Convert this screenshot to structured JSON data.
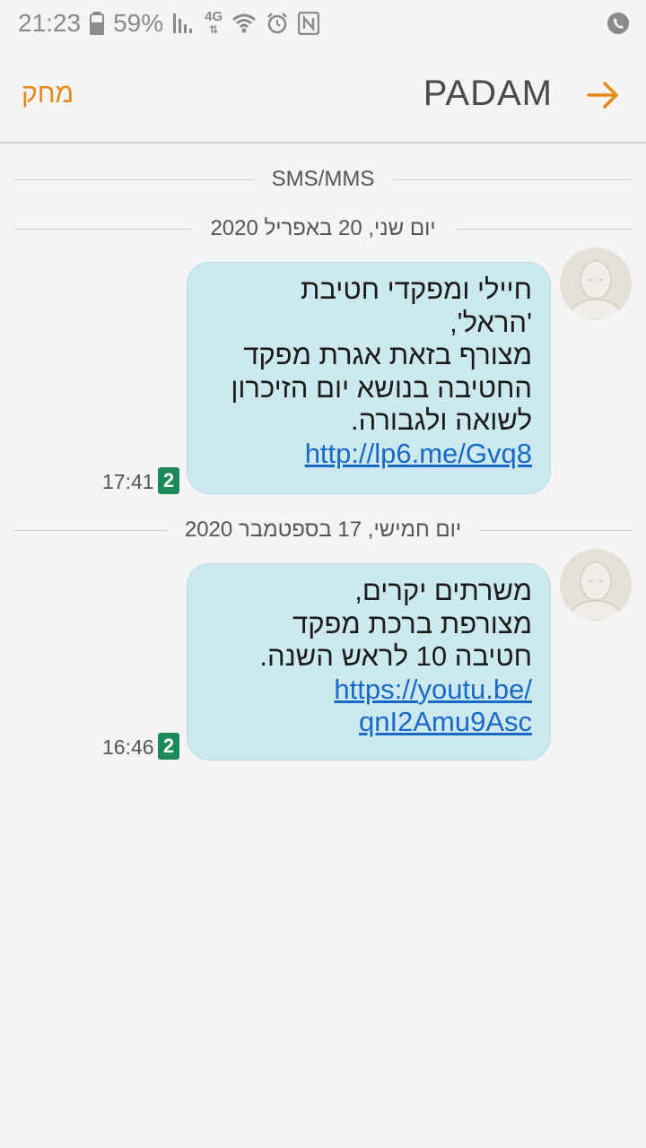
{
  "status_bar": {
    "time": "21:23",
    "battery": "59%",
    "network": "4G",
    "icons": [
      "battery-icon",
      "signal-icon",
      "wifi-icon",
      "alarm-icon",
      "nfc-icon",
      "call-icon"
    ]
  },
  "header": {
    "delete_label": "מחק",
    "title": "PADAM",
    "back_icon": "arrow-right-icon",
    "accent_color": "#e8891c"
  },
  "thread": {
    "type_label": "SMS/MMS",
    "messages": [
      {
        "date": "יום שני, 20 באפריל 2020",
        "lines": [
          "חיילי ומפקדי חטיבת",
          "'הראל',",
          "מצורף בזאת אגרת מפקד",
          "החטיבה בנושא יום הזיכרון",
          "לשואה ולגבורה."
        ],
        "link": "http://lp6.me/Gvq8",
        "time": "17:41",
        "sim": "2"
      },
      {
        "date": "יום חמישי, 17 בספטמבר 2020",
        "lines": [
          "משרתים יקרים,",
          "מצורפת ברכת מפקד",
          "חטיבה 10 לראש השנה."
        ],
        "link_lines": [
          "https://youtu.be/",
          "qnI2Amu9Asc"
        ],
        "time": "16:46",
        "sim": "2"
      }
    ]
  }
}
